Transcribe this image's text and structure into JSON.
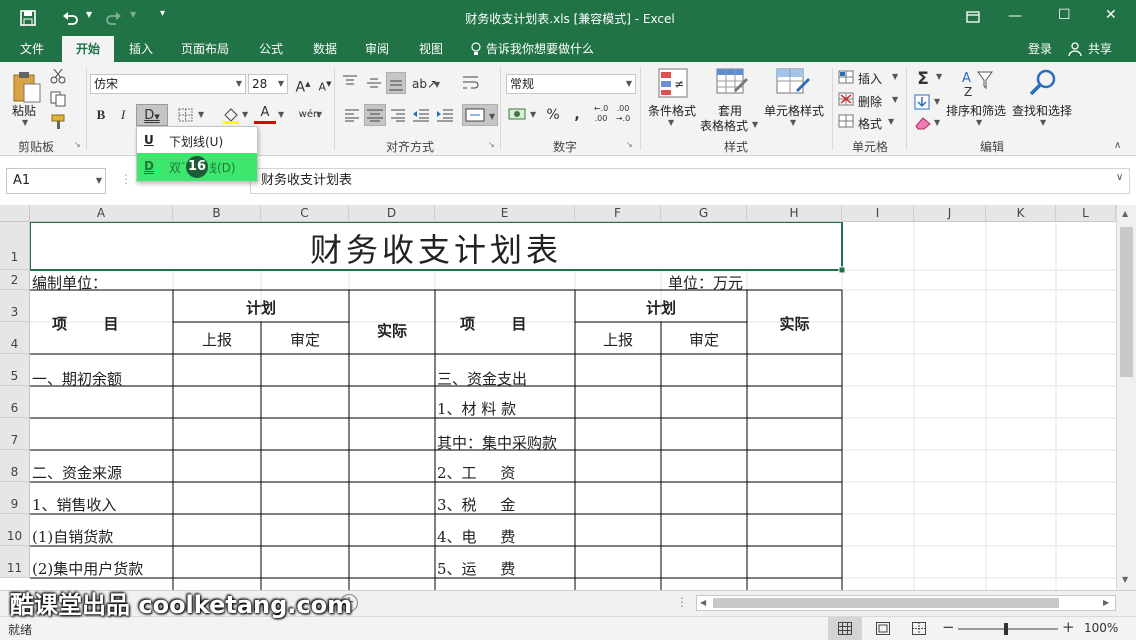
{
  "titlebar": {
    "title": "财务收支计划表.xls  [兼容模式] - Excel",
    "minimize": "—",
    "restore": "☐",
    "close": "✕"
  },
  "tabs": [
    "文件",
    "开始",
    "插入",
    "页面布局",
    "公式",
    "数据",
    "审阅",
    "视图"
  ],
  "tellme": "告诉我你想要做什么",
  "login": "登录",
  "share": "共享",
  "ribbon": {
    "clipboard": {
      "paste": "粘贴",
      "label": "剪贴板"
    },
    "font": {
      "name": "仿宋",
      "size": "28",
      "label": "字体"
    },
    "alignment": {
      "label": "对齐方式"
    },
    "number": {
      "format": "常规",
      "label": "数字",
      "percent": "%"
    },
    "styles": {
      "conditional": "条件格式",
      "table1": "套用",
      "table2": "表格格式",
      "cell": "单元格样式",
      "label": "样式"
    },
    "cells": {
      "insert": "插入",
      "delete": "删除",
      "format": "格式",
      "label": "单元格"
    },
    "editing": {
      "sort": "排序和筛选",
      "find": "查找和选择",
      "label": "编辑"
    }
  },
  "underline_menu": {
    "items": [
      {
        "icon": "U",
        "label": "下划线(U)"
      },
      {
        "icon": "D",
        "label": "双下划线(D)"
      }
    ],
    "step_badge": "16"
  },
  "namebox": "A1",
  "formula": "财务收支计划表",
  "columns": [
    "A",
    "B",
    "C",
    "D",
    "E",
    "F",
    "G",
    "H",
    "I",
    "J",
    "K",
    "L"
  ],
  "rows": [
    "1",
    "2",
    "3",
    "4",
    "5",
    "6",
    "7",
    "8",
    "9",
    "10",
    "11"
  ],
  "sheet": {
    "title": "财务收支计划表",
    "unit_left": "编制单位：",
    "unit_right": "单位：万元",
    "hdr_item": "项       目",
    "hdr_plan": "计划",
    "hdr_report": "上报",
    "hdr_approve": "审定",
    "hdr_actual": "实际",
    "left_items": [
      "一、期初余额",
      "",
      "",
      "二、资金来源",
      "1、销售收入",
      "(1)自销货款",
      "(2)集中用户货款"
    ],
    "right_items": [
      "三、资金支出",
      "1、材 料 款",
      "其中：集中采购款",
      "2、工     资",
      "3、税     金",
      "4、电     费",
      "5、运     费"
    ]
  },
  "watermark": "酷课堂出品 coolketang.com",
  "status": {
    "ready": "就绪",
    "zoom": "100%"
  }
}
